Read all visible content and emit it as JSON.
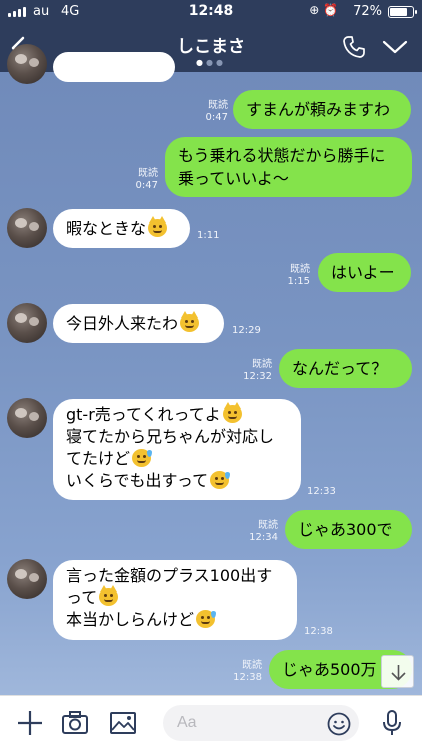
{
  "status_bar": {
    "carrier": "au",
    "network": "4G",
    "time": "12:48",
    "battery": "72%"
  },
  "header": {
    "title": "しこまさ"
  },
  "messages": [
    {
      "side": "out",
      "text": "すまんが頼みますわ",
      "read": "既読",
      "time": "0:47"
    },
    {
      "side": "out",
      "line1": "もう乗れる状態だから勝手に",
      "line2": "乗っていいよ〜",
      "read": "既読",
      "time": "0:47"
    },
    {
      "side": "in",
      "text": "暇なときな",
      "time": "1:11"
    },
    {
      "side": "out",
      "text": "はいよー",
      "read": "既読",
      "time": "1:15"
    },
    {
      "side": "in",
      "text": "今日外人来たわ",
      "time": "12:29"
    },
    {
      "side": "out",
      "text": "なんだって？",
      "read": "既読",
      "time": "12:32"
    },
    {
      "side": "in",
      "line1": "gt-r売ってくれってよ",
      "line2": "寝てたから兄ちゃんが対応し",
      "line3": "てたけど",
      "line4": "いくらでも出すって",
      "time": "12:33"
    },
    {
      "side": "out",
      "text": "じゃあ300で",
      "read": "既読",
      "time": "12:34"
    },
    {
      "side": "in",
      "line1": "言った金額のプラス100出す",
      "line2": "って",
      "line3": "本当かしらんけど",
      "time": "12:38"
    },
    {
      "side": "out",
      "text": "じゃあ500万",
      "read": "既読",
      "time": "12:38"
    }
  ],
  "input": {
    "placeholder": "Aa"
  },
  "icons": {
    "back": "chevron-left-icon",
    "call": "phone-icon",
    "menu": "chevron-down-icon",
    "add": "plus-icon",
    "camera": "camera-icon",
    "image": "image-icon",
    "emoji": "smiley-icon",
    "voice": "microphone-icon",
    "scroll": "arrow-down-icon"
  },
  "colors": {
    "header": "#2e3d5c",
    "outgoing_bubble": "#84e34b",
    "incoming_bubble": "#ffffff",
    "chat_background": "#7994c2"
  }
}
